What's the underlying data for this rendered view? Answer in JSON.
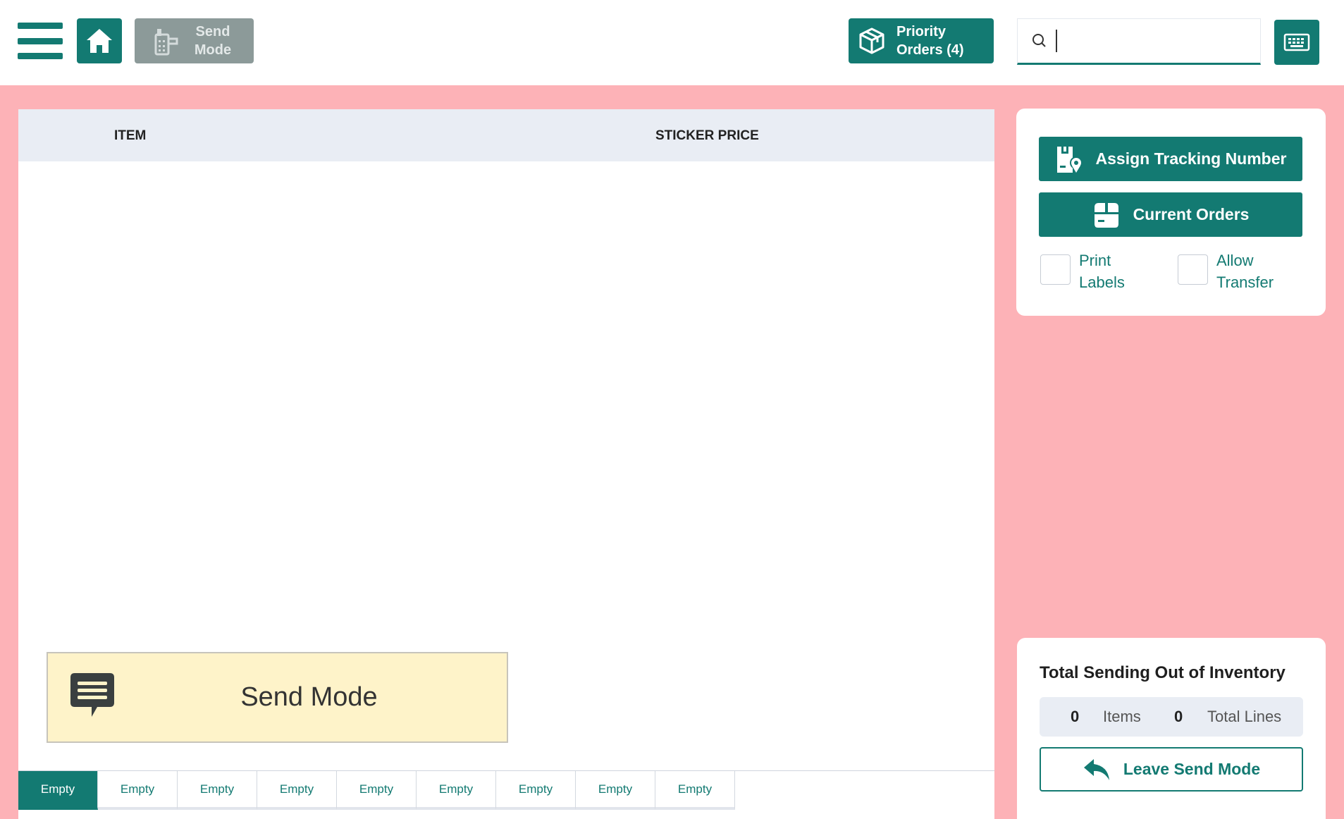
{
  "topbar": {
    "menu_icon": "hamburger-icon",
    "home_icon": "home-icon",
    "send_mode_label": "Send Mode",
    "priority_orders_label": "Priority Orders (4)",
    "search_value": "",
    "keyboard_icon": "keyboard-icon"
  },
  "table": {
    "columns": [
      "ITEM",
      "STICKER PRICE"
    ],
    "rows": []
  },
  "banner": {
    "text": "Send Mode",
    "icon": "chat-icon"
  },
  "tabs": [
    "Empty",
    "Empty",
    "Empty",
    "Empty",
    "Empty",
    "Empty",
    "Empty",
    "Empty",
    "Empty"
  ],
  "actions": {
    "assign_tracking_label": "Assign Tracking Number",
    "current_orders_label": "Current Orders",
    "print_labels_label": "Print Labels",
    "allow_transfer_label": "Allow Transfer",
    "print_labels_checked": false,
    "allow_transfer_checked": false
  },
  "totals": {
    "title": "Total Sending Out of Inventory",
    "items_value": "0",
    "items_label": "Items",
    "lines_value": "0",
    "lines_label": "Total Lines",
    "leave_label": "Leave Send Mode"
  },
  "colors": {
    "accent": "#137a72",
    "background": "#fdb2b7",
    "banner": "#fef3c9",
    "header_row": "#e9edf4"
  }
}
